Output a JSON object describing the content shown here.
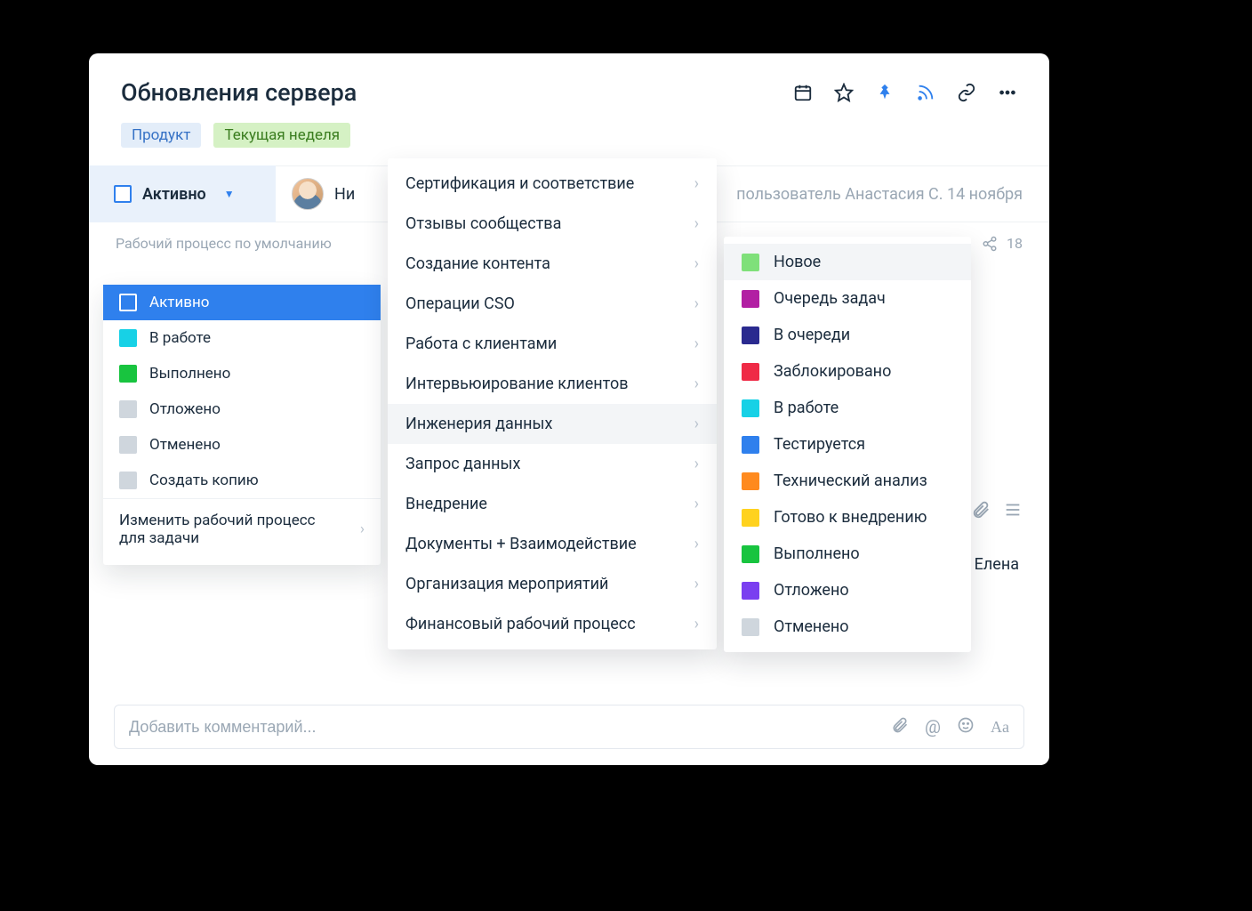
{
  "header": {
    "title": "Обновления сервера",
    "tags": [
      {
        "label": "Продукт",
        "kind": "blue"
      },
      {
        "label": "Текущая неделя",
        "kind": "green"
      }
    ]
  },
  "status_row": {
    "status": "Активно",
    "assignee_partial": "Ни",
    "meta": "пользователь Анастасия С. 14 ноября"
  },
  "subheader": {
    "label": "Рабочий процесс по умолчанию",
    "share_count": "18"
  },
  "dd1": {
    "items": [
      {
        "label": "Активно",
        "color": "outline",
        "selected": true
      },
      {
        "label": "В работе",
        "color": "#17d1e6"
      },
      {
        "label": "Выполнено",
        "color": "#18c43f"
      },
      {
        "label": "Отложено",
        "color": "#cfd6dd"
      },
      {
        "label": "Отменено",
        "color": "#cfd6dd"
      },
      {
        "label": "Создать копию",
        "color": "#cfd6dd"
      }
    ],
    "footer": "Изменить рабочий процесс для задачи"
  },
  "dd2": {
    "items": [
      {
        "label": "Сертификация и соответствие"
      },
      {
        "label": "Отзывы сообщества"
      },
      {
        "label": "Создание контента"
      },
      {
        "label": "Операции CSO"
      },
      {
        "label": "Работа с клиентами"
      },
      {
        "label": "Интервьюирование клиентов"
      },
      {
        "label": "Инженерия данных",
        "hover": true
      },
      {
        "label": "Запрос данных"
      },
      {
        "label": "Внедрение"
      },
      {
        "label": "Документы + Взаимодействие"
      },
      {
        "label": "Организация мероприятий"
      },
      {
        "label": "Финансовый рабочий процесс"
      }
    ]
  },
  "dd3": {
    "items": [
      {
        "label": "Новое",
        "color": "#7fe07a",
        "hover": true
      },
      {
        "label": "Очередь задач",
        "color": "#b21fa3"
      },
      {
        "label": "В очереди",
        "color": "#2a2a8f"
      },
      {
        "label": "Заблокировано",
        "color": "#ef2a46"
      },
      {
        "label": "В работе",
        "color": "#17d1e6"
      },
      {
        "label": "Тестируется",
        "color": "#2f80ed"
      },
      {
        "label": "Технический анализ",
        "color": "#ff8a1e"
      },
      {
        "label": "Готово к внедрению",
        "color": "#ffd21e"
      },
      {
        "label": "Выполнено",
        "color": "#18c43f"
      },
      {
        "label": "Отложено",
        "color": "#7a3ff0"
      },
      {
        "label": "Отменено",
        "color": "#cfd6dd"
      }
    ]
  },
  "side": {
    "name": "Елена"
  },
  "comment": {
    "placeholder": "Добавить комментарий..."
  }
}
